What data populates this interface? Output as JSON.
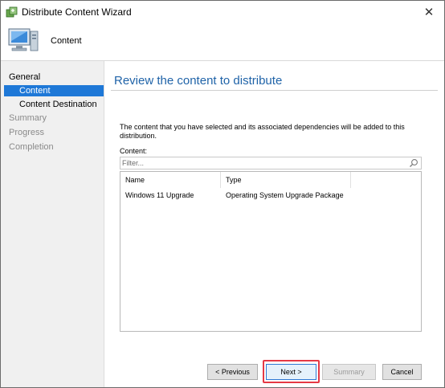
{
  "window": {
    "title": "Distribute Content Wizard",
    "close_glyph": "✕"
  },
  "header": {
    "page_name": "Content"
  },
  "sidebar": {
    "items": [
      {
        "label": "General",
        "state": "section"
      },
      {
        "label": "Content",
        "state": "active"
      },
      {
        "label": "Content Destination",
        "state": "normal"
      },
      {
        "label": "Summary",
        "state": "disabled"
      },
      {
        "label": "Progress",
        "state": "disabled"
      },
      {
        "label": "Completion",
        "state": "disabled"
      }
    ]
  },
  "main": {
    "title": "Review the content to distribute",
    "description": "The content that you have selected and its associated dependencies will be added to this distribution.",
    "content_label": "Content:",
    "filter_placeholder": "Filter...",
    "table": {
      "columns": [
        "Name",
        "Type"
      ],
      "rows": [
        [
          "Windows 11 Upgrade",
          "Operating System Upgrade Package"
        ]
      ]
    }
  },
  "buttons": {
    "previous": "< Previous",
    "next": "Next >",
    "summary": "Summary",
    "cancel": "Cancel"
  },
  "colors": {
    "accent": "#1e78d7",
    "title_blue": "#1f63a8",
    "highlight": "#e53945"
  }
}
